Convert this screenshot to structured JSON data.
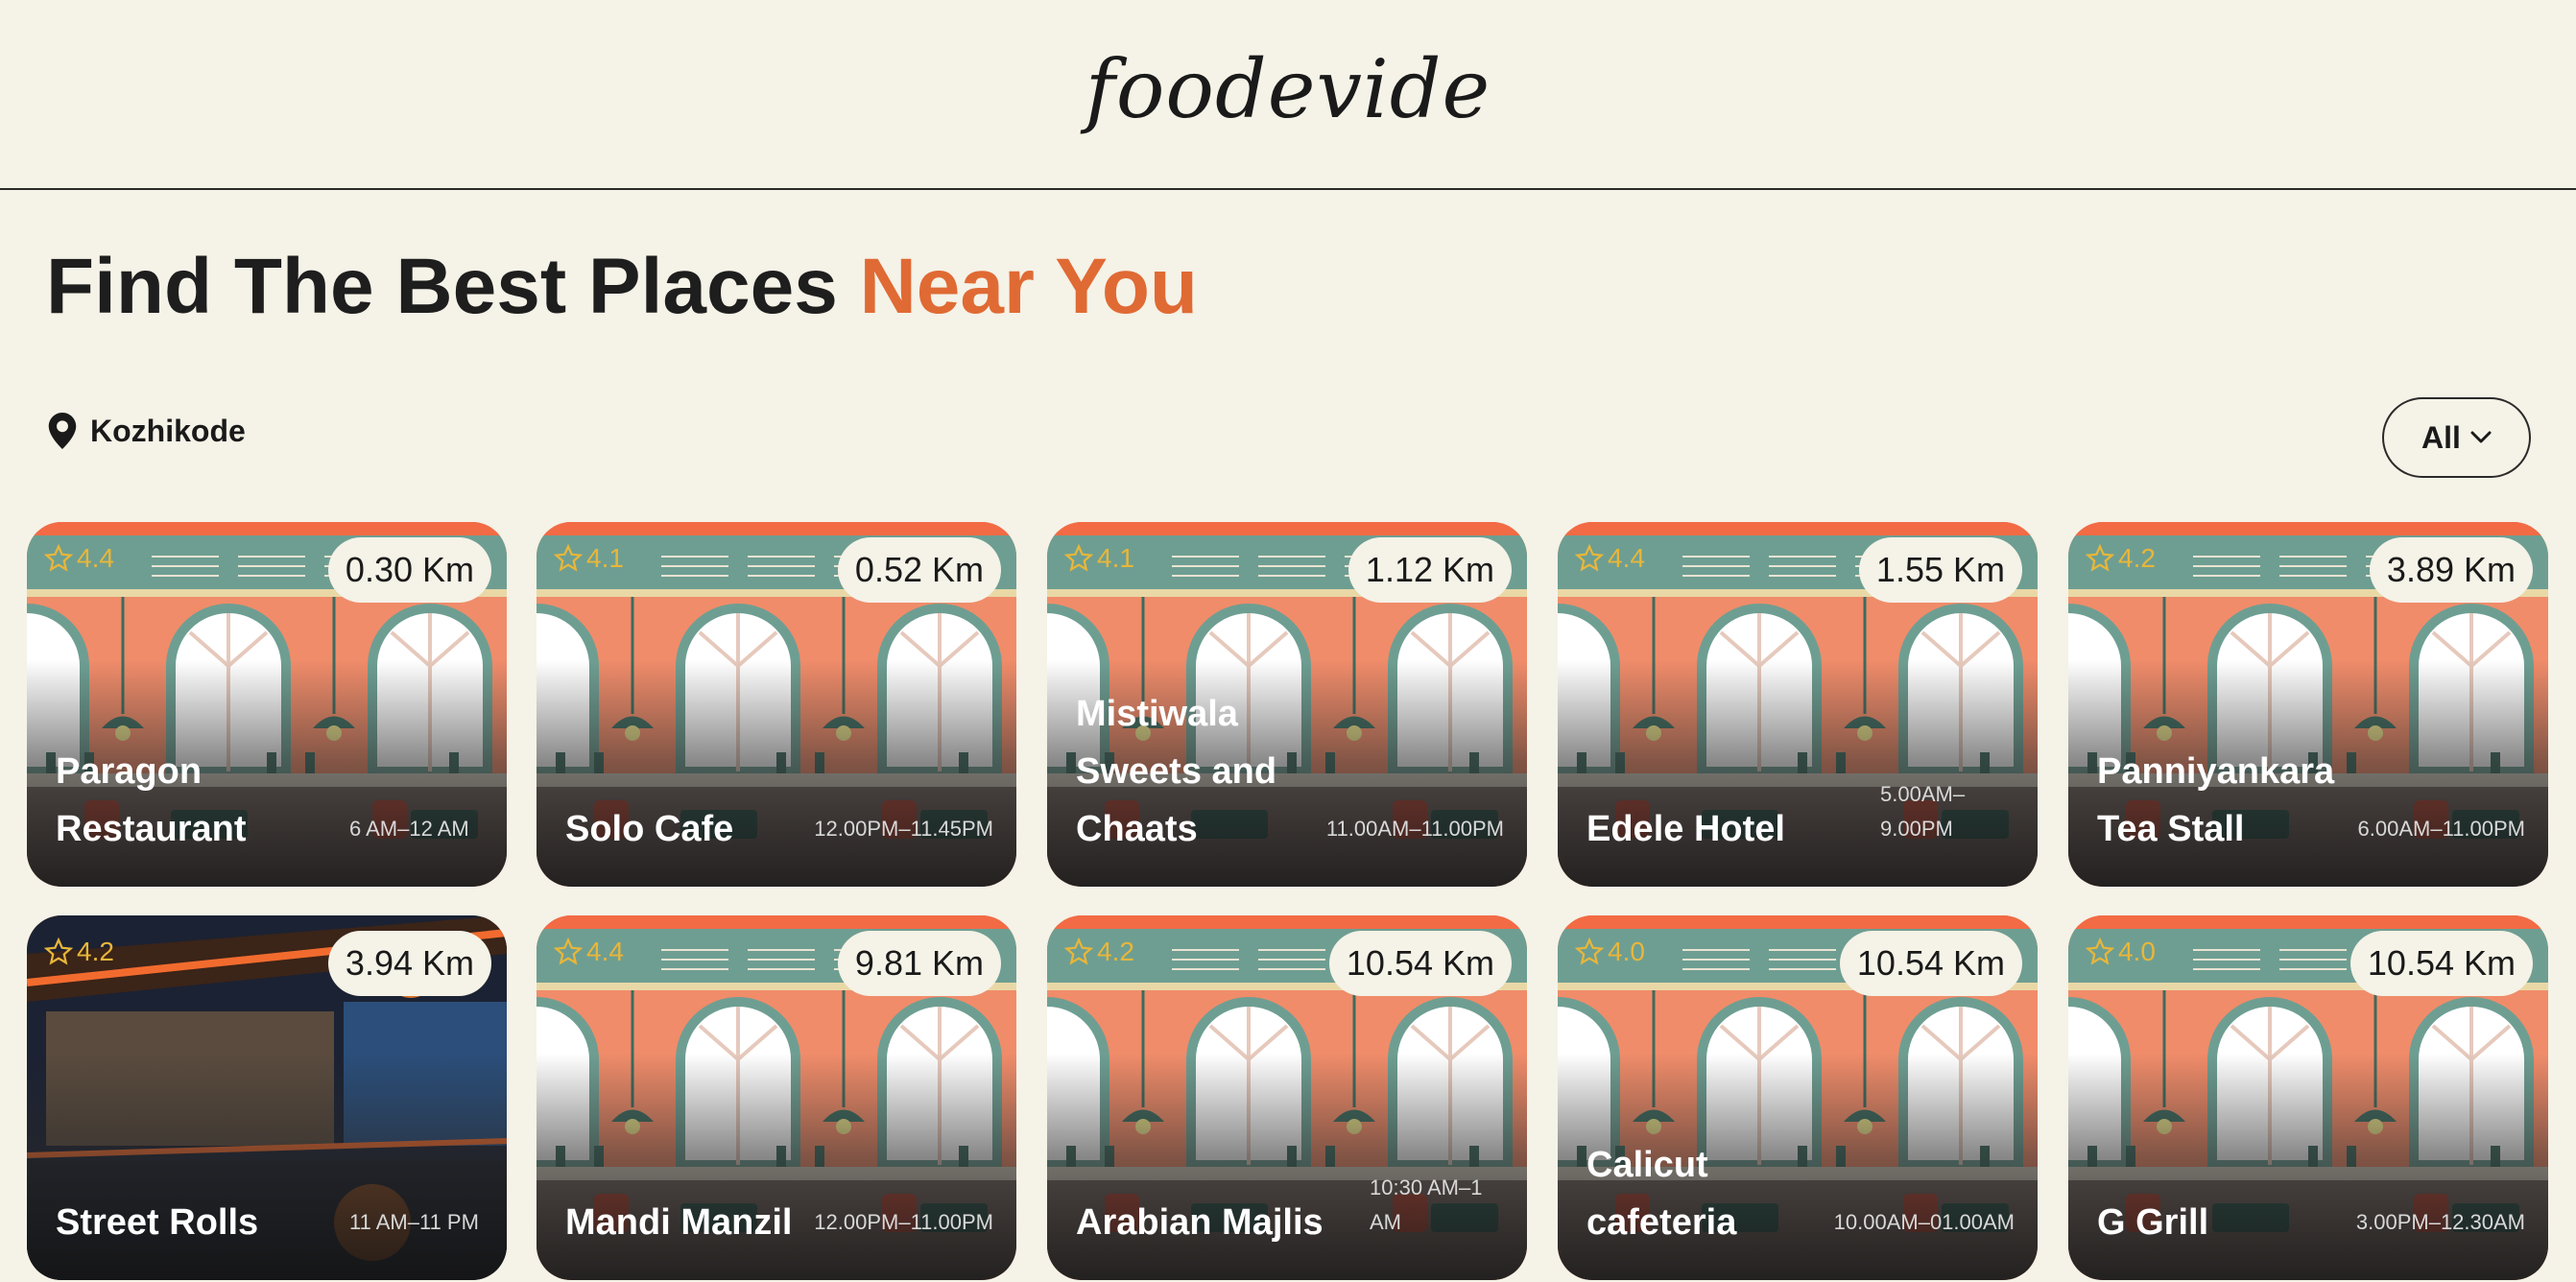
{
  "header": {
    "logo": "foodevide"
  },
  "hero": {
    "title_prefix": "Find The Best Places ",
    "title_accent": "Near You"
  },
  "location": {
    "city": "Kozhikode"
  },
  "filter": {
    "label": "All"
  },
  "colors": {
    "accent": "#e06a34",
    "background": "#f5f2e7",
    "star": "#e8b63a"
  },
  "places": [
    {
      "name": "Paragon Restaurant",
      "hours": "6 AM–12 AM",
      "distance": "0.30 Km",
      "rating": "4.4",
      "art": "illustration"
    },
    {
      "name": "Solo Cafe",
      "hours": "12.00PM–11.45PM",
      "distance": "0.52 Km",
      "rating": "4.1",
      "art": "illustration"
    },
    {
      "name": "Mistiwala Sweets and Chaats",
      "hours": "11.00AM–11.00PM",
      "distance": "1.12 Km",
      "rating": "4.1",
      "art": "illustration"
    },
    {
      "name": "Edele Hotel",
      "hours": "5.00AM–9.00PM",
      "distance": "1.55 Km",
      "rating": "4.4",
      "art": "illustration"
    },
    {
      "name": "Panniyankara Tea Stall",
      "hours": "6.00AM–11.00PM",
      "distance": "3.89 Km",
      "rating": "4.2",
      "art": "illustration"
    },
    {
      "name": "Street Rolls",
      "hours": "11 AM–11 PM",
      "distance": "3.94 Km",
      "rating": "4.2",
      "art": "photo"
    },
    {
      "name": "Mandi Manzil",
      "hours": "12.00PM–11.00PM",
      "distance": "9.81 Km",
      "rating": "4.4",
      "art": "illustration"
    },
    {
      "name": "Arabian Majlis",
      "hours": "10:30 AM–1 AM",
      "distance": "10.54 Km",
      "rating": "4.2",
      "art": "illustration"
    },
    {
      "name": "Calicut cafeteria",
      "hours": "10.00AM–01.00AM",
      "distance": "10.54 Km",
      "rating": "4.0",
      "art": "illustration"
    },
    {
      "name": "G Grill",
      "hours": "3.00PM–12.30AM",
      "distance": "10.54 Km",
      "rating": "4.0",
      "art": "illustration"
    }
  ]
}
